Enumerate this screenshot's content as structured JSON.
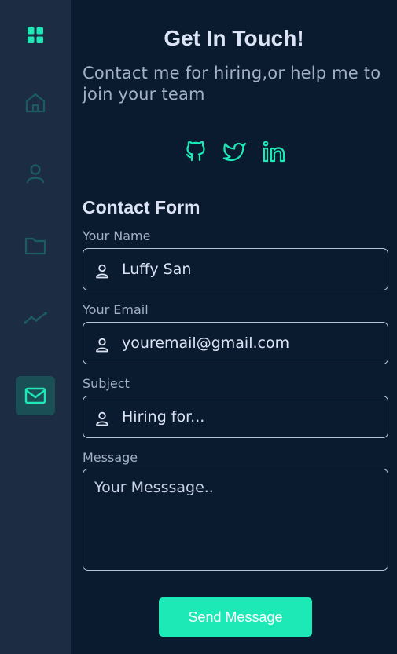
{
  "colors": {
    "accent": "#1de9b6",
    "sidebar_bg": "#1c2d43",
    "page_bg": "#0a1a2f",
    "icon_muted": "#1b5c62",
    "active_bg": "#1b4f56"
  },
  "sidebar": {
    "items": [
      {
        "icon": "home-icon"
      },
      {
        "icon": "user-icon"
      },
      {
        "icon": "folder-icon"
      },
      {
        "icon": "trend-icon"
      },
      {
        "icon": "mail-icon",
        "active": true
      }
    ]
  },
  "header": {
    "title": "Get In Touch!",
    "subtitle": "Contact me for hiring,or help me to join your team"
  },
  "socials": [
    "github-icon",
    "twitter-icon",
    "linkedin-icon"
  ],
  "form": {
    "title": "Contact Form",
    "name_label": "Your Name",
    "name_value": "Luffy San",
    "email_label": "Your Email",
    "email_value": "youremail@gmail.com",
    "subject_label": "Subject",
    "subject_value": "Hiring for...",
    "message_label": "Message",
    "message_placeholder": "Your Messsage..",
    "submit_label": "Send Message"
  }
}
